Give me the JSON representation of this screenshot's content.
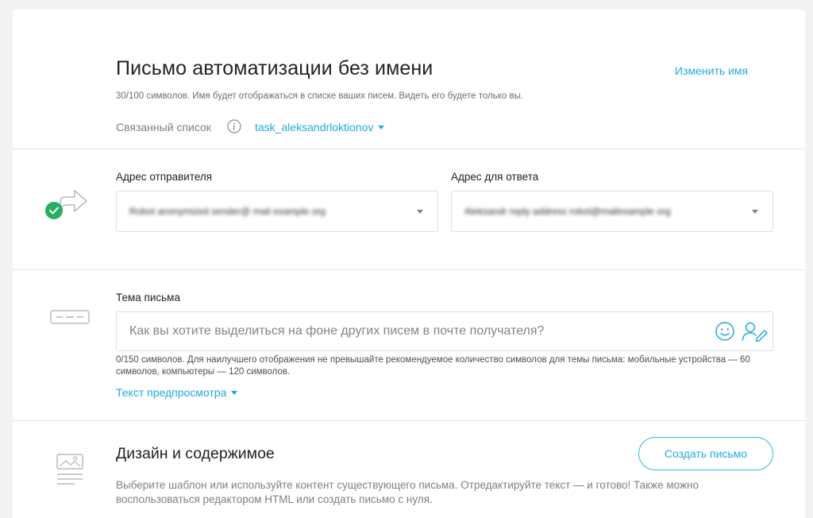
{
  "header": {
    "title": "Письмо автоматизации без имени",
    "rename_link": "Изменить имя",
    "name_hint": "30/100 символов. Имя будет отображаться в списке ваших писем. Видеть его будете только вы.",
    "list_label": "Связанный список",
    "list_value": "task_aleksandrloktionov"
  },
  "sender": {
    "from_label": "Адрес отправителя",
    "from_value": "Robot anonymized sender@ mail example org",
    "reply_label": "Адрес для ответа",
    "reply_value": "Aleksandr reply address robot@mailexample org",
    "status_icon": "check-circle-icon",
    "section_icon": "share-arrow-icon"
  },
  "subject": {
    "label": "Тема письма",
    "placeholder": "Как вы хотите выделиться на фоне других писем в почте получателя?",
    "value": "",
    "counter_hint": "0/150 символов. Для наилучшего отображения не превышайте рекомендуемое количество символов для темы письма: мобильные устройства — 60 символов, компьютеры — 120 символов.",
    "preview_link": "Текст предпросмотра",
    "emoji_icon": "smiley-icon",
    "personalize_icon": "person-edit-icon",
    "section_icon": "subject-line-icon"
  },
  "design": {
    "title": "Дизайн и содержимое",
    "create_button": "Создать письмо",
    "description": "Выберите шаблон или используйте контент существующего письма. Отредактируйте текст — и готово! Также можно воспользоваться редактором HTML или создать письмо с нуля.",
    "section_icon": "image-layout-icon"
  },
  "colors": {
    "accent": "#21a9e1",
    "success": "#27ae60",
    "border": "#dcdfe3",
    "background": "#f2f3f5"
  }
}
